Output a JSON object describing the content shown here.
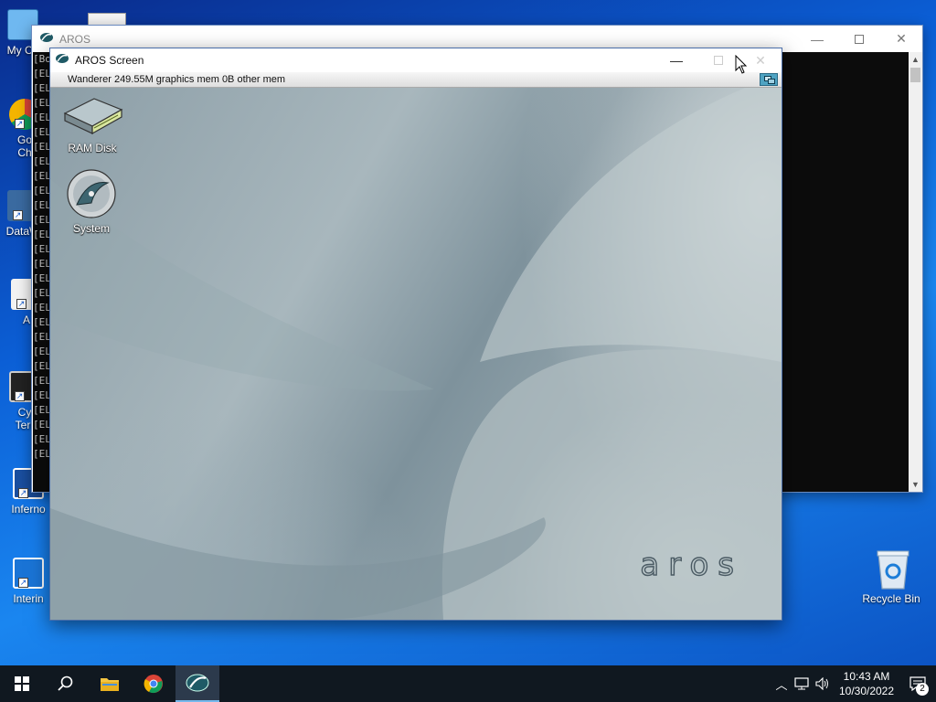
{
  "desktop": {
    "icons": [
      {
        "label": "My Co"
      },
      {
        "label": "Go\nCh"
      },
      {
        "label": "DataW"
      },
      {
        "label": "A"
      },
      {
        "label": "Cy\nTerr"
      },
      {
        "label": "Inferno"
      },
      {
        "label": "Interin"
      }
    ],
    "recycle_bin_label": "Recycle Bin"
  },
  "console_window": {
    "title": "AROS",
    "first_line": "[Bo",
    "line_prefix": "[EL",
    "line_count": 27
  },
  "aros_screen_window": {
    "title": "AROS Screen",
    "wanderer_status": "Wanderer 249.55M graphics mem 0B other mem",
    "icons": [
      {
        "label": "RAM Disk"
      },
      {
        "label": "System"
      }
    ],
    "logo_text": "aros"
  },
  "taskbar": {
    "time": "10:43 AM",
    "date": "10/30/2022",
    "notification_count": "2"
  },
  "colors": {
    "taskbar": "#101820",
    "accent": "#76b9ed",
    "desktop_blue": "#0b5fd6"
  }
}
